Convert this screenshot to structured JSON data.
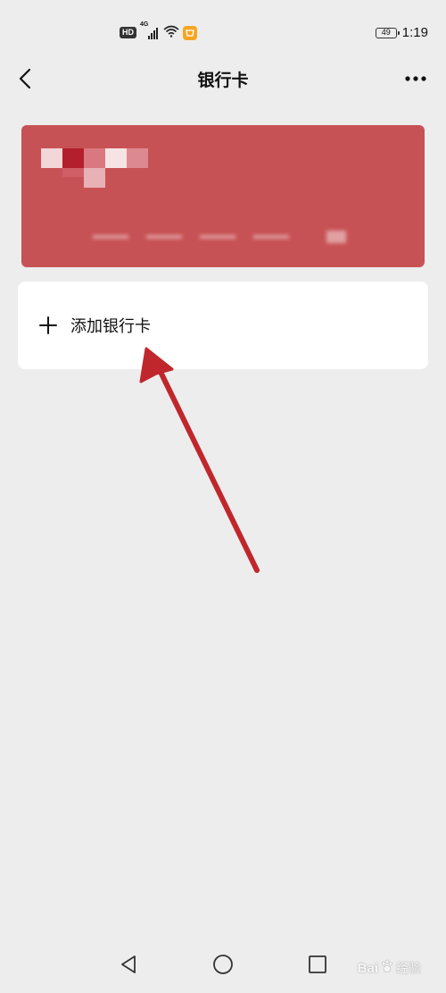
{
  "status_bar": {
    "hd": "HD",
    "network": "4G",
    "battery": "49",
    "time": "1:19"
  },
  "nav": {
    "title": "银行卡"
  },
  "add_card": {
    "label": "添加银行卡"
  },
  "watermark": {
    "brand": "Bai",
    "suffix": "经验"
  },
  "colors": {
    "card": "#c75255",
    "background": "#ededed",
    "arrow": "#c0272d",
    "row": "#ffffff"
  },
  "icons": {
    "back": "chevron-left-icon",
    "more": "more-horizontal-icon",
    "add": "plus-icon",
    "sys_back": "triangle-back-icon",
    "sys_home": "circle-home-icon",
    "sys_recent": "square-recent-icon"
  }
}
